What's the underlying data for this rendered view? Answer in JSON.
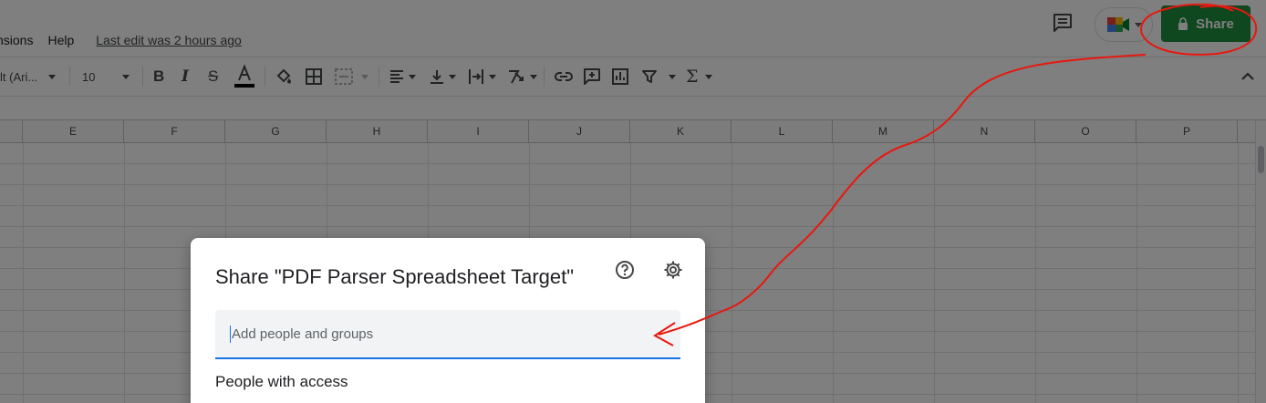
{
  "menu": {
    "items": [
      "nsions",
      "Help"
    ],
    "last_edit": "Last edit was 2 hours ago"
  },
  "header": {
    "share_label": "Share",
    "icons": [
      "comment-icon",
      "meet-icon",
      "lock-icon"
    ]
  },
  "toolbar": {
    "font_name": "lt (Ari...",
    "font_size": "10",
    "icons": [
      "bold-icon",
      "italic-icon",
      "strikethrough-icon",
      "text-color-icon",
      "fill-color-icon",
      "borders-icon",
      "merge-cells-icon",
      "align-left-icon",
      "vertical-align-icon",
      "text-wrap-icon",
      "text-rotation-icon",
      "link-icon",
      "insert-comment-icon",
      "insert-chart-icon",
      "filter-icon",
      "functions-icon",
      "collapse-icon"
    ]
  },
  "grid": {
    "columns": [
      "E",
      "F",
      "G",
      "H",
      "I",
      "J",
      "K",
      "L",
      "M",
      "N",
      "O",
      "P"
    ]
  },
  "dialog": {
    "title": "Share \"PDF Parser Spreadsheet Target\"",
    "input_placeholder": "Add people and groups",
    "people_with_access": "People with access",
    "icons": [
      "help-icon",
      "gear-icon"
    ]
  },
  "colors": {
    "share_button": "#1e8e3e",
    "annotation": "#e8170f",
    "focus": "#1a73e8"
  }
}
